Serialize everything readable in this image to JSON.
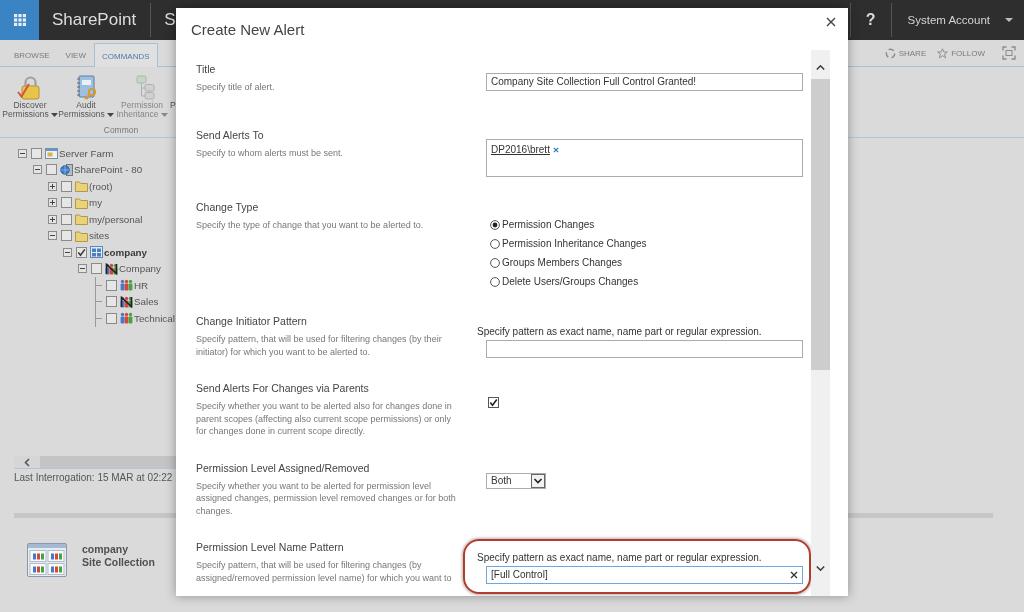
{
  "top_bar": {
    "app_title": "SharePoint",
    "site_title": "S",
    "help": "?",
    "user": "System Account"
  },
  "ribbon": {
    "tabs": [
      {
        "label": "BROWSE",
        "selected": false
      },
      {
        "label": "VIEW",
        "selected": false
      },
      {
        "label": "COMMANDS",
        "selected": true
      }
    ],
    "actions": [
      {
        "kind": "share",
        "label": "SHARE"
      },
      {
        "kind": "follow",
        "label": "FOLLOW"
      }
    ],
    "group": {
      "label": "Common",
      "buttons": [
        {
          "kind": "discover",
          "label": "Discover Permissions",
          "dropdown": true,
          "disabled": false
        },
        {
          "kind": "audit",
          "label": "Audit Permissions",
          "dropdown": true,
          "disabled": false
        },
        {
          "kind": "inheritance",
          "label": "Permission Inheritance",
          "dropdown": true,
          "disabled": true
        },
        {
          "kind": "partial",
          "label": "P",
          "disabled": false
        }
      ]
    }
  },
  "tree": [
    {
      "label": "Server Farm",
      "kind": "farm",
      "expanded": true,
      "checked": false,
      "selected": false,
      "children": [
        {
          "label": "SharePoint - 80",
          "kind": "webapp",
          "expanded": true,
          "checked": false,
          "selected": false,
          "children": [
            {
              "label": "(root)",
              "kind": "folder",
              "expanded": false,
              "checked": false,
              "selected": false
            },
            {
              "label": "my",
              "kind": "folder",
              "expanded": false,
              "checked": false,
              "selected": false
            },
            {
              "label": "my/personal",
              "kind": "folder",
              "expanded": false,
              "checked": false,
              "selected": false
            },
            {
              "label": "sites",
              "kind": "folder",
              "expanded": true,
              "checked": false,
              "selected": false,
              "children": [
                {
                  "label": "company",
                  "kind": "collection",
                  "expanded": true,
                  "checked": true,
                  "selected": true,
                  "children": [
                    {
                      "label": "Company",
                      "kind": "unique",
                      "expanded": true,
                      "checked": false,
                      "selected": false,
                      "children": [
                        {
                          "label": "HR",
                          "kind": "site",
                          "checked": false,
                          "selected": false
                        },
                        {
                          "label": "Sales",
                          "kind": "unique",
                          "checked": false,
                          "selected": false
                        },
                        {
                          "label": "Technical",
                          "kind": "site",
                          "checked": false,
                          "selected": false
                        }
                      ]
                    }
                  ]
                }
              ]
            }
          ]
        }
      ]
    }
  ],
  "status": "Last Interrogation: 15 MAR at 02:22",
  "selection": {
    "name": "company",
    "type": "Site Collection"
  },
  "dialog": {
    "title": "Create New Alert",
    "fields": [
      {
        "kind": "text",
        "label": "Title",
        "description": "Specify title of alert.",
        "value": "Company Site Collection Full Control Granted!"
      },
      {
        "kind": "people",
        "label": "Send Alerts To",
        "description": "Specify to whom alerts must be sent.",
        "people": [
          "DP2016\\brett"
        ]
      },
      {
        "kind": "radio",
        "label": "Change Type",
        "description": "Specify the type of change that you want to be alerted to.",
        "options": [
          {
            "label": "Permission Changes",
            "selected": true
          },
          {
            "label": "Permission Inheritance Changes",
            "selected": false
          },
          {
            "label": "Groups Members Changes",
            "selected": false
          },
          {
            "label": "Delete Users/Groups Changes",
            "selected": false
          }
        ]
      },
      {
        "kind": "pattern",
        "label": "Change Initiator Pattern",
        "description": "Specify pattern, that will be used for filtering changes (by their initiator) for which you want to be alerted to.",
        "hint": "Specify pattern as exact name, name part or regular expression.",
        "focused": false,
        "highlighted": false
      },
      {
        "kind": "checkbox",
        "label": "Send Alerts For Changes via Parents",
        "description": "Specify whether you want to be alerted also for changes done in parent scopes (affecting also current scope permissions) or only for changes done in current scope directly.",
        "checked": true
      },
      {
        "kind": "select",
        "label": "Permission Level Assigned/Removed",
        "description": "Specify whether you want to be alerted for permission level assigned changes, permission level removed changes or for both changes.",
        "value": "Both"
      },
      {
        "kind": "pattern",
        "label": "Permission Level Name Pattern",
        "description": "Specify pattern, that will be used for filtering changes (by assigned/removed permission level name) for which you want to",
        "hint": "Specify pattern as exact name, name part or regular expression.",
        "value": "[Full Control]",
        "focused": true,
        "highlighted": true
      }
    ]
  }
}
